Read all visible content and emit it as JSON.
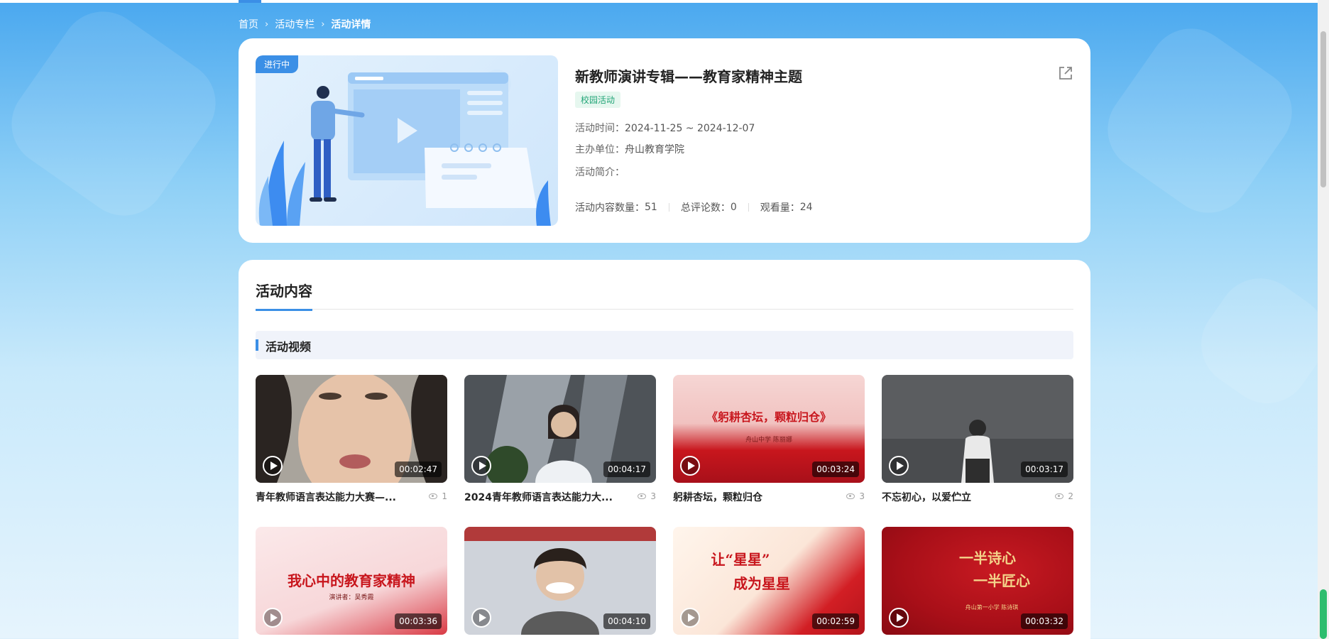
{
  "breadcrumb": {
    "home": "首页",
    "column": "活动专栏",
    "current": "活动详情",
    "sep": "›"
  },
  "activity": {
    "status": "进行中",
    "title": "新教师演讲专辑——教育家精神主题",
    "category": "校园活动",
    "time_label": "活动时间：",
    "time_value": "2024-11-25 ~ 2024-12-07",
    "org_label": "主办单位：",
    "org_value": "舟山教育学院",
    "intro_label": "活动简介：",
    "intro_value": "",
    "stats": {
      "content_label": "活动内容数量：",
      "content_value": "51",
      "comments_label": "总评论数：",
      "comments_value": "0",
      "views_label": "观看量：",
      "views_value": "24"
    }
  },
  "content_tab": "活动内容",
  "section": "活动视频",
  "videos": [
    {
      "title": "青年教师语言表达能力大赛—...",
      "duration": "00:02:47",
      "views": "1"
    },
    {
      "title": "2024青年教师语言表达能力大...",
      "duration": "00:04:17",
      "views": "3"
    },
    {
      "title": "躬耕杏坛，颗粒归仓",
      "duration": "00:03:24",
      "views": "3",
      "thumb_text": "《躬耕杏坛，颗粒归仓》",
      "thumb_sub": "舟山中学  陈丽娜"
    },
    {
      "title": "不忘初心，以爱伫立",
      "duration": "00:03:17",
      "views": "2"
    },
    {
      "title": "",
      "duration": "00:03:36",
      "views": "",
      "thumb_text": "我心中的教育家精神",
      "thumb_sub": "演讲者：吴秀霞"
    },
    {
      "title": "",
      "duration": "00:04:10",
      "views": ""
    },
    {
      "title": "",
      "duration": "00:02:59",
      "views": "",
      "thumb_text": "让“星星”",
      "thumb_text2": "成为星星"
    },
    {
      "title": "",
      "duration": "00:03:32",
      "views": "",
      "thumb_text": "一半诗心",
      "thumb_text2": "一半匠心",
      "thumb_sub": "舟山第一小学  陈诗琪"
    }
  ],
  "colors": {
    "accent": "#3b8fe6",
    "tag_green": "#22a577",
    "red": "#c8161d"
  },
  "icons": {
    "share": "external-link-icon",
    "play": "play-icon",
    "views": "eye-icon"
  }
}
